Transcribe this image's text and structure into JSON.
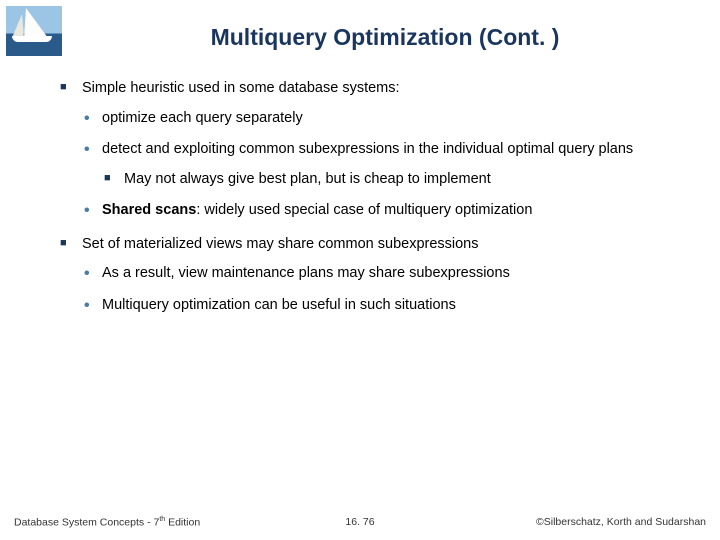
{
  "title": "Multiquery Optimization (Cont. )",
  "body": {
    "p1": "Simple heuristic used in some database systems:",
    "p1a": "optimize each query separately",
    "p1b": "detect and exploiting common subexpressions in the individual optimal query plans",
    "p1b1": "May not always give best plan, but is cheap to implement",
    "p1c_strong": "Shared scans",
    "p1c_rest": ": widely used special case of multiquery optimization",
    "p2": "Set of materialized views may share common subexpressions",
    "p2a": "As a result, view maintenance plans may share subexpressions",
    "p2b": "Multiquery optimization can be useful in such situations"
  },
  "footer": {
    "left_a": "Database System Concepts - 7",
    "left_sup": "th",
    "left_b": " Edition",
    "center": "16. 76",
    "right": "©Silberschatz, Korth and Sudarshan"
  }
}
